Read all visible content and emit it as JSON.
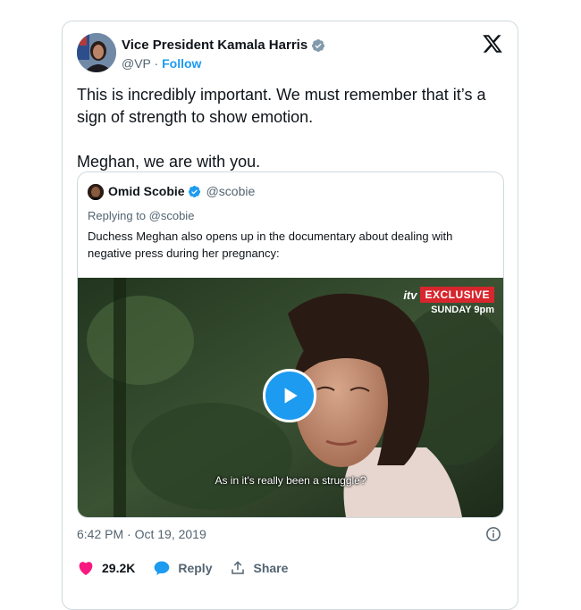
{
  "tweet": {
    "author_name": "Vice President Kamala Harris",
    "author_handle": "@VP",
    "separator": "·",
    "follow_label": "Follow",
    "text_paragraph_1": "This is incredibly important. We must remember that it’s a sign of strength to show emotion.",
    "text_paragraph_2": "Meghan, we are with you.",
    "timestamp": "6:42 PM · Oct 19, 2019",
    "likes": "29.2K",
    "reply_label": "Reply",
    "share_label": "Share",
    "icons": [
      "verified-badge-icon",
      "x-logo-icon",
      "info-icon",
      "heart-icon",
      "reply-bubble-icon",
      "share-icon"
    ]
  },
  "quote": {
    "author_name": "Omid Scobie",
    "author_handle": "@scobie",
    "replying_to": "Replying to @scobie",
    "text": "Duchess Meghan also opens up in the documentary about dealing with negative press during her pregnancy:",
    "video": {
      "logo_text": "itv",
      "exclusive_label": "EXCLUSIVE",
      "schedule_label": "SUNDAY 9pm",
      "subtitle": "As in it's really been a struggle?",
      "icons": [
        "play-icon"
      ]
    }
  },
  "colors": {
    "accent": "#1d9bf0",
    "like": "#f91880",
    "exclusive_red": "#d7262d",
    "text_secondary": "#536471"
  }
}
